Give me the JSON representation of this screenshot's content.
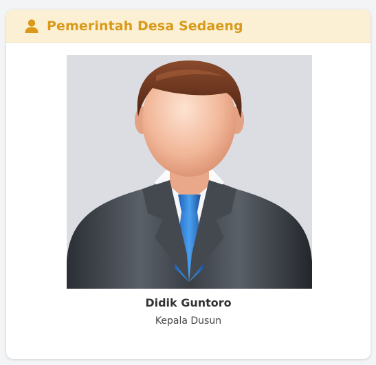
{
  "header": {
    "title": "Pemerintah Desa Sedaeng",
    "icon": "user-icon",
    "accent_color": "#d99a1a",
    "background_color": "#fbf0d3"
  },
  "profile": {
    "photo_icon": "male-avatar-icon",
    "name": "Didik Guntoro",
    "role": "Kepala Dusun"
  }
}
